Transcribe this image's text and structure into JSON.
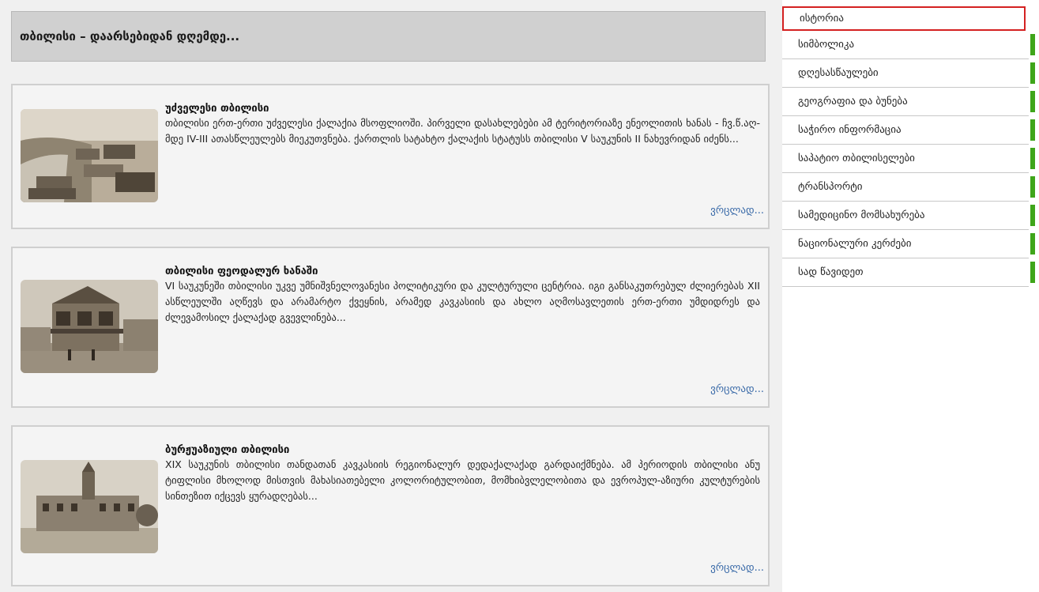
{
  "header": {
    "title": "თბილისი – დაარსებიდან დღემდე..."
  },
  "articles": [
    {
      "title": "უძველესი თბილისი",
      "body": "თბილისი ერთ-ერთი უძველესი ქალაქია მსოფლიოში. პირველი დასახლებები ამ ტერიტორიაზე ენეოლითის ხანას - ჩვ.წ.აღ-მდე IV-III ათასწლეულებს მიეკუთვნება. ქართლის სატახტო ქალაქის სტატუსს თბილისი V საუკუნის II ნახევრიდან იძენს...",
      "more": "ვრცლად..."
    },
    {
      "title": "თბილისი ფეოდალურ ხანაში",
      "body": "VI საუკუნეში თბილისი უკვე უმნიშვნელოვანესი პოლიტიკური და კულტურული ცენტრია. იგი განსაკუთრებულ ძლიერებას XII ასწლეულში აღწევს და არამარტო ქვეყნის, არამედ კავკასიის და ახლო აღმოსავლეთის ერთ-ერთი უმდიდრეს და ძლევამოსილ ქალაქად გვევლინება...",
      "more": "ვრცლად..."
    },
    {
      "title": "ბურჟუაზიული თბილისი",
      "body": "XIX საუკუნის თბილისი თანდათან კავკასიის რეგიონალურ დედაქალაქად გარდაიქმნება. ამ პერიოდის თბილისი ანუ ტიფლისი მხოლოდ მისთვის მახასიათებელი კოლორიტულობით, მომხიბვლელობითა და ევროპულ-აზიური კულტურების სინთეზით იქცევს ყურადღებას...",
      "more": "ვრცლად..."
    }
  ],
  "sidebar": {
    "items": [
      {
        "label": "ისტორია",
        "active": true
      },
      {
        "label": "სიმბოლიკა"
      },
      {
        "label": "დღესასწაულები"
      },
      {
        "label": "გეოგრაფია და ბუნება"
      },
      {
        "label": "საჭირო ინფორმაცია"
      },
      {
        "label": "საპატიო თბილისელები"
      },
      {
        "label": "ტრანსპორტი"
      },
      {
        "label": "სამედიცინო მომსახურება"
      },
      {
        "label": "ნაციონალური კერძები"
      },
      {
        "label": "სად წავიდეთ"
      }
    ],
    "accent_color": "#3fa51a",
    "active_border_color": "#d42121"
  }
}
